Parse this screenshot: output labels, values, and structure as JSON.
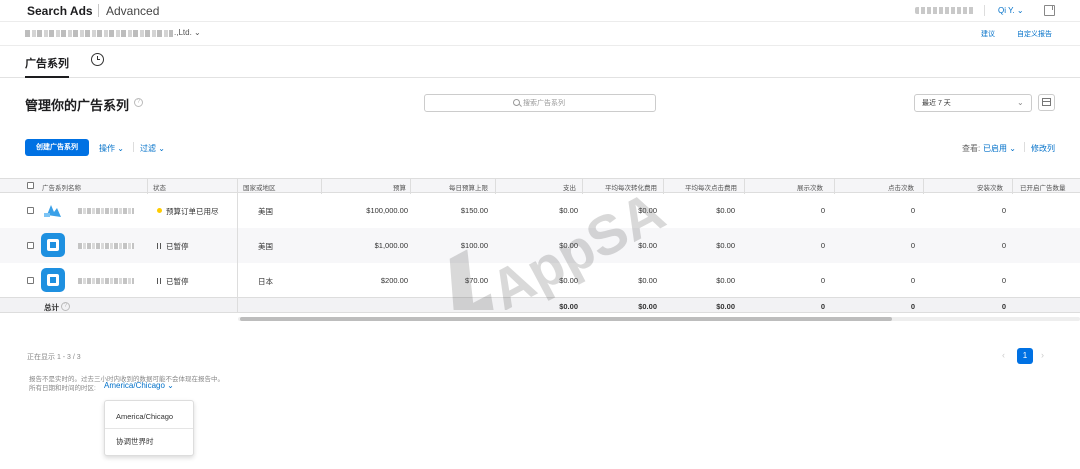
{
  "header": {
    "apple_glyph": "",
    "brand": "Search Ads",
    "mode": "Advanced",
    "mode_chevron": "⌄",
    "user_name": "Qi Y. ⌄"
  },
  "org": {
    "name_suffix": ".,Ltd. ⌄",
    "link_suggestions": "建议",
    "link_custom_reports": "自定义报告"
  },
  "tabs": {
    "campaigns": "广告系列"
  },
  "page": {
    "title": "管理你的广告系列",
    "help_glyph": "?",
    "search_placeholder": "搜索广告系列",
    "date_range": "最近 7 天",
    "date_chevron": "⌄"
  },
  "toolbar": {
    "create": "创建广告系列",
    "actions": "操作 ⌄",
    "filter": "过滤 ⌄",
    "view_label": "查看:",
    "view_value": "已启用 ⌄",
    "edit_columns": "修改列"
  },
  "table": {
    "columns": {
      "name": "广告系列名称",
      "status": "状态",
      "region": "国家或地区",
      "budget": "预算",
      "daily_cap": "每日预算上限",
      "spend": "支出",
      "avg_cpa": "平均每次转化费用",
      "avg_cpt": "平均每次点击费用",
      "impressions": "展示次数",
      "taps": "点击次数",
      "installs": "安装次数",
      "enabled_ads": "已开启广告数量"
    },
    "rows": [
      {
        "status": "预算订单已用尽",
        "region": "美国",
        "budget": "$100,000.00",
        "daily_cap": "$150.00",
        "spend": "$0.00",
        "avg_cpa": "$0.00",
        "avg_cpt": "$0.00",
        "impressions": "0",
        "taps": "0",
        "installs": "0",
        "status_type": "exhausted"
      },
      {
        "status": "已暂停",
        "region": "美国",
        "budget": "$1,000.00",
        "daily_cap": "$100.00",
        "spend": "$0.00",
        "avg_cpa": "$0.00",
        "avg_cpt": "$0.00",
        "impressions": "0",
        "taps": "0",
        "installs": "0",
        "status_type": "paused"
      },
      {
        "status": "已暂停",
        "region": "日本",
        "budget": "$200.00",
        "daily_cap": "$70.00",
        "spend": "$0.00",
        "avg_cpa": "$0.00",
        "avg_cpt": "$0.00",
        "impressions": "0",
        "taps": "0",
        "installs": "0",
        "status_type": "paused"
      }
    ],
    "totals": {
      "label": "总计",
      "spend": "$0.00",
      "avg_cpa": "$0.00",
      "avg_cpt": "$0.00",
      "impressions": "0",
      "taps": "0",
      "installs": "0"
    }
  },
  "footer": {
    "showing": "正在显示 1 - 3 / 3",
    "page_prev": "‹",
    "page_current": "1",
    "page_next": "›",
    "note_line1": "报告不是实时的。过去三小时内收到的数据可能不会体现在报告中。",
    "note_line2": "所有日期和时间的时区:",
    "timezone": "America/Chicago ⌄",
    "timezone_options": [
      "America/Chicago",
      "协调世界时"
    ]
  },
  "watermark": "AppSA",
  "colors": {
    "accent": "#0071e3",
    "link": "#0070c9",
    "status_exhausted": "#ffcc00"
  }
}
